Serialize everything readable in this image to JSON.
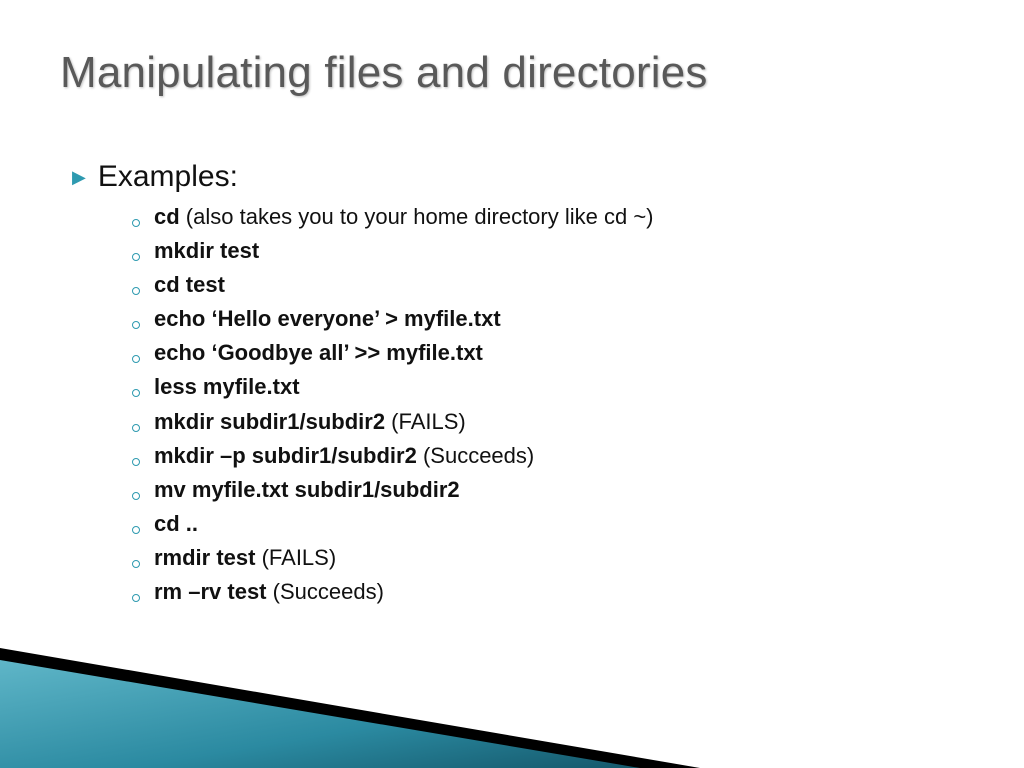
{
  "title": "Manipulating files and directories",
  "topBullet": "Examples:",
  "subItems": [
    {
      "bold": "cd",
      "norm": " (also takes you to your home directory like cd ~)"
    },
    {
      "bold": "mkdir test",
      "norm": ""
    },
    {
      "bold": "cd test",
      "norm": ""
    },
    {
      "bold": "echo ‘Hello everyone’ > myfile.txt",
      "norm": ""
    },
    {
      "bold": "echo ‘Goodbye all’ >> myfile.txt",
      "norm": ""
    },
    {
      "bold": "less myfile.txt",
      "norm": ""
    },
    {
      "bold": "mkdir subdir1/subdir2",
      "norm": " (FAILS)"
    },
    {
      "bold": "mkdir –p subdir1/subdir2",
      "norm": " (Succeeds)"
    },
    {
      "bold": "mv myfile.txt subdir1/subdir2",
      "norm": ""
    },
    {
      "bold": "cd ..",
      "norm": ""
    },
    {
      "bold": "rmdir test",
      "norm": " (FAILS)"
    },
    {
      "bold": "rm –rv test",
      "norm": " (Succeeds)"
    }
  ]
}
